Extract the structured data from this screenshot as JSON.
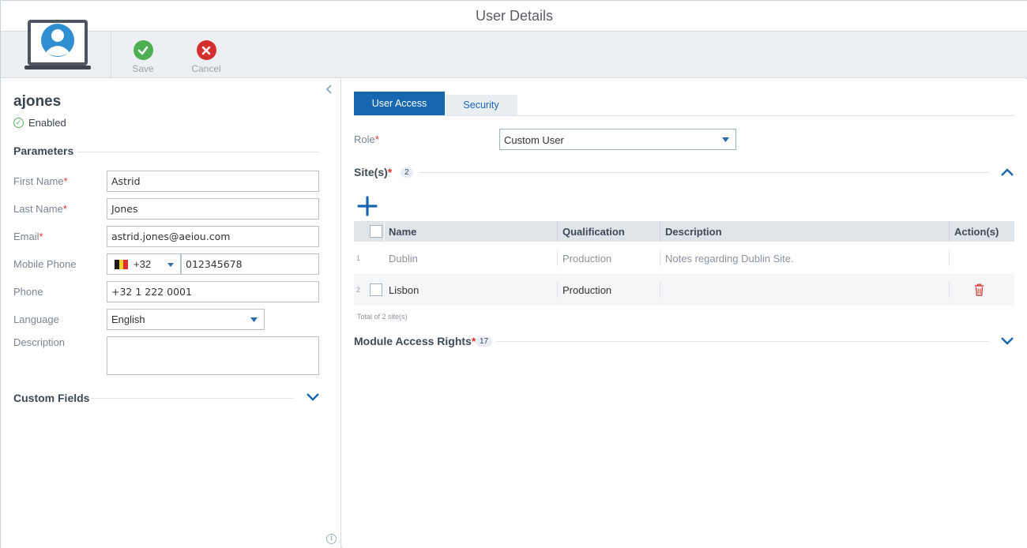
{
  "window": {
    "title": "User Details"
  },
  "toolbar": {
    "save_label": "Save",
    "cancel_label": "Cancel"
  },
  "user": {
    "username": "ajones",
    "status": "Enabled"
  },
  "parameters": {
    "heading": "Parameters",
    "first_name_label": "First Name",
    "first_name": "Astrid",
    "last_name_label": "Last Name",
    "last_name": "Jones",
    "email_label": "Email",
    "email": "astrid.jones@aeiou.com",
    "mobile_label": "Mobile Phone",
    "mobile_code": "+32",
    "mobile_number": "012345678",
    "phone_label": "Phone",
    "phone": "+32 1 222 0001",
    "language_label": "Language",
    "language": "English",
    "description_label": "Description",
    "description": "",
    "required_mark": "*"
  },
  "custom_fields": {
    "heading": "Custom Fields"
  },
  "tabs": [
    {
      "label": "User Access",
      "active": true
    },
    {
      "label": "Security",
      "active": false
    }
  ],
  "role": {
    "label": "Role",
    "value": "Custom User"
  },
  "sites": {
    "title": "Site(s)",
    "count": "2",
    "columns": [
      "Name",
      "Qualification",
      "Description",
      "Action(s)"
    ],
    "rows": [
      {
        "index": "1",
        "name": "Dublin",
        "qualification": "Production",
        "description": "Notes regarding Dublin Site."
      },
      {
        "index": "2",
        "name": "Lisbon",
        "qualification": "Production",
        "description": ""
      }
    ],
    "total": "Total of 2 site(s)"
  },
  "module_access": {
    "title": "Module Access Rights",
    "count": "17"
  },
  "colors": {
    "accent": "#1767b0",
    "save_green": "#4caf50",
    "cancel_red": "#d32f2f",
    "required_red": "#d93535",
    "delete_red": "#d9453a"
  },
  "icons": [
    "laptop-user-icon",
    "save-check-icon",
    "cancel-x-icon",
    "collapse-left-icon",
    "enabled-check-icon",
    "chevron-down-icon",
    "chevron-up-icon",
    "add-plus-icon",
    "trash-icon",
    "info-icon",
    "belgium-flag-icon"
  ]
}
